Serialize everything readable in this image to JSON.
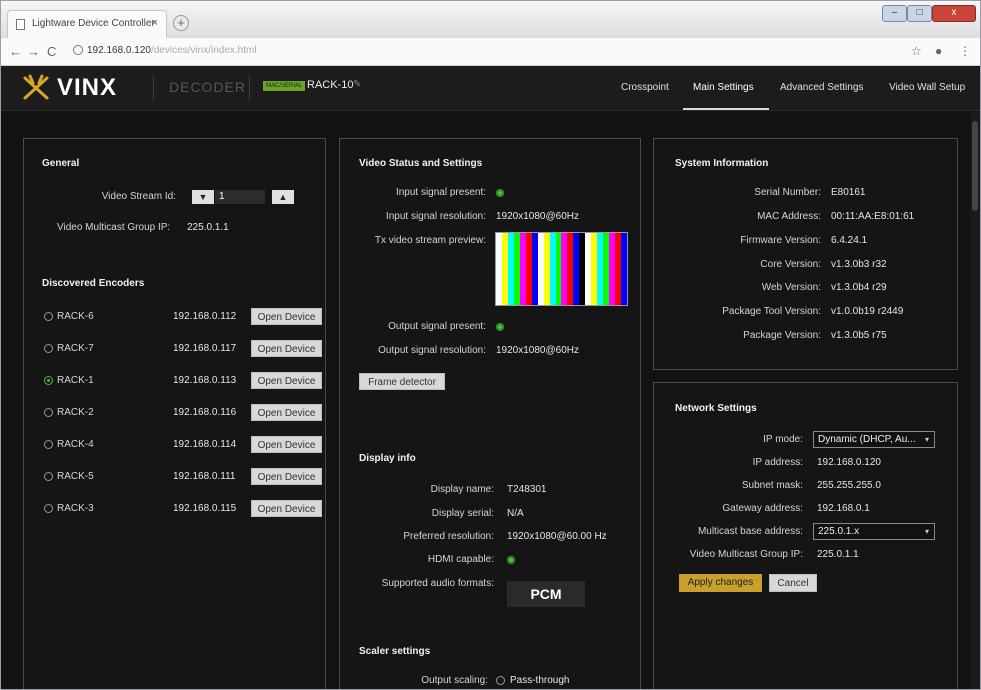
{
  "browser": {
    "tab_title": "Lightware Device Controller",
    "tab_close": "×",
    "new_tab": "+",
    "url_host": "192.168.0.120",
    "url_path": "/devices/vinx/index.html",
    "min": "–",
    "max": "□",
    "close": "x"
  },
  "app": {
    "logo": "VINX",
    "mode": "DECODER",
    "device_badge": "MAC/SERIAL",
    "device_name": "RACK-10",
    "edit_icon": "✎",
    "nav": [
      "Crosspoint",
      "Main Settings",
      "Advanced Settings",
      "Video Wall Setup"
    ]
  },
  "general": {
    "title": "General",
    "stream_id_label": "Video Stream Id:",
    "stream_id_value": "1",
    "down": "▼",
    "up": "▲",
    "multicast_label": "Video Multicast Group IP:",
    "multicast_value": "225.0.1.1"
  },
  "encoders": {
    "title": "Discovered Encoders",
    "button_label": "Open Device",
    "items": [
      {
        "name": "RACK-6",
        "ip": "192.168.0.112",
        "selected": false
      },
      {
        "name": "RACK-7",
        "ip": "192.168.0.117",
        "selected": false
      },
      {
        "name": "RACK-1",
        "ip": "192.168.0.113",
        "selected": true
      },
      {
        "name": "RACK-2",
        "ip": "192.168.0.116",
        "selected": false
      },
      {
        "name": "RACK-4",
        "ip": "192.168.0.114",
        "selected": false
      },
      {
        "name": "RACK-5",
        "ip": "192.168.0.111",
        "selected": false
      },
      {
        "name": "RACK-3",
        "ip": "192.168.0.115",
        "selected": false
      }
    ]
  },
  "video": {
    "title": "Video Status and Settings",
    "input_present_label": "Input signal present:",
    "input_res_label": "Input signal resolution:",
    "input_res_value": "1920x1080@60Hz",
    "preview_label": "Tx video stream preview:",
    "preview_colors": [
      "#ffffff",
      "#ffff00",
      "#00ffff",
      "#00ff00",
      "#ff00ff",
      "#ff0000",
      "#0000ff",
      "#ffffff",
      "#ffff00",
      "#00ffff",
      "#00ff00",
      "#ff00ff",
      "#ff0000",
      "#0000ff",
      "#000000",
      "#ffffff",
      "#ffff00",
      "#00ffff",
      "#00ff00",
      "#ff00ff",
      "#ff0000",
      "#0000ff"
    ],
    "output_present_label": "Output signal present:",
    "output_res_label": "Output signal resolution:",
    "output_res_value": "1920x1080@60Hz",
    "frame_detector": "Frame detector"
  },
  "display": {
    "title": "Display info",
    "name_label": "Display name:",
    "name_value": "T248301",
    "serial_label": "Display serial:",
    "serial_value": "N/A",
    "pref_res_label": "Preferred resolution:",
    "pref_res_value": "1920x1080@60.00 Hz",
    "hdmi_label": "HDMI capable:",
    "audio_label": "Supported audio formats:",
    "audio_value": "PCM"
  },
  "scaler": {
    "title": "Scaler settings",
    "output_scaling_label": "Output scaling:",
    "output_scaling_value": "Pass-through"
  },
  "system": {
    "title": "System Information",
    "rows": [
      {
        "label": "Serial Number:",
        "value": "E80161"
      },
      {
        "label": "MAC Address:",
        "value": "00:11:AA:E8:01:61"
      },
      {
        "label": "Firmware Version:",
        "value": "6.4.24.1"
      },
      {
        "label": "Core Version:",
        "value": "v1.3.0b3 r32"
      },
      {
        "label": "Web Version:",
        "value": "v1.3.0b4 r29"
      },
      {
        "label": "Package Tool Version:",
        "value": "v1.0.0b19 r2449"
      },
      {
        "label": "Package Version:",
        "value": "v1.3.0b5 r75"
      }
    ]
  },
  "network": {
    "title": "Network Settings",
    "ip_mode_label": "IP mode:",
    "ip_mode_value": "Dynamic (DHCP, Au...",
    "ip_label": "IP address:",
    "ip_value": "192.168.0.120",
    "mask_label": "Subnet mask:",
    "mask_value": "255.255.255.0",
    "gw_label": "Gateway address:",
    "gw_value": "192.168.0.1",
    "mc_base_label": "Multicast base address:",
    "mc_base_value": "225.0.1.x",
    "vmg_label": "Video Multicast Group IP:",
    "vmg_value": "225.0.1.1",
    "apply": "Apply changes",
    "cancel": "Cancel",
    "caret": "▾"
  }
}
